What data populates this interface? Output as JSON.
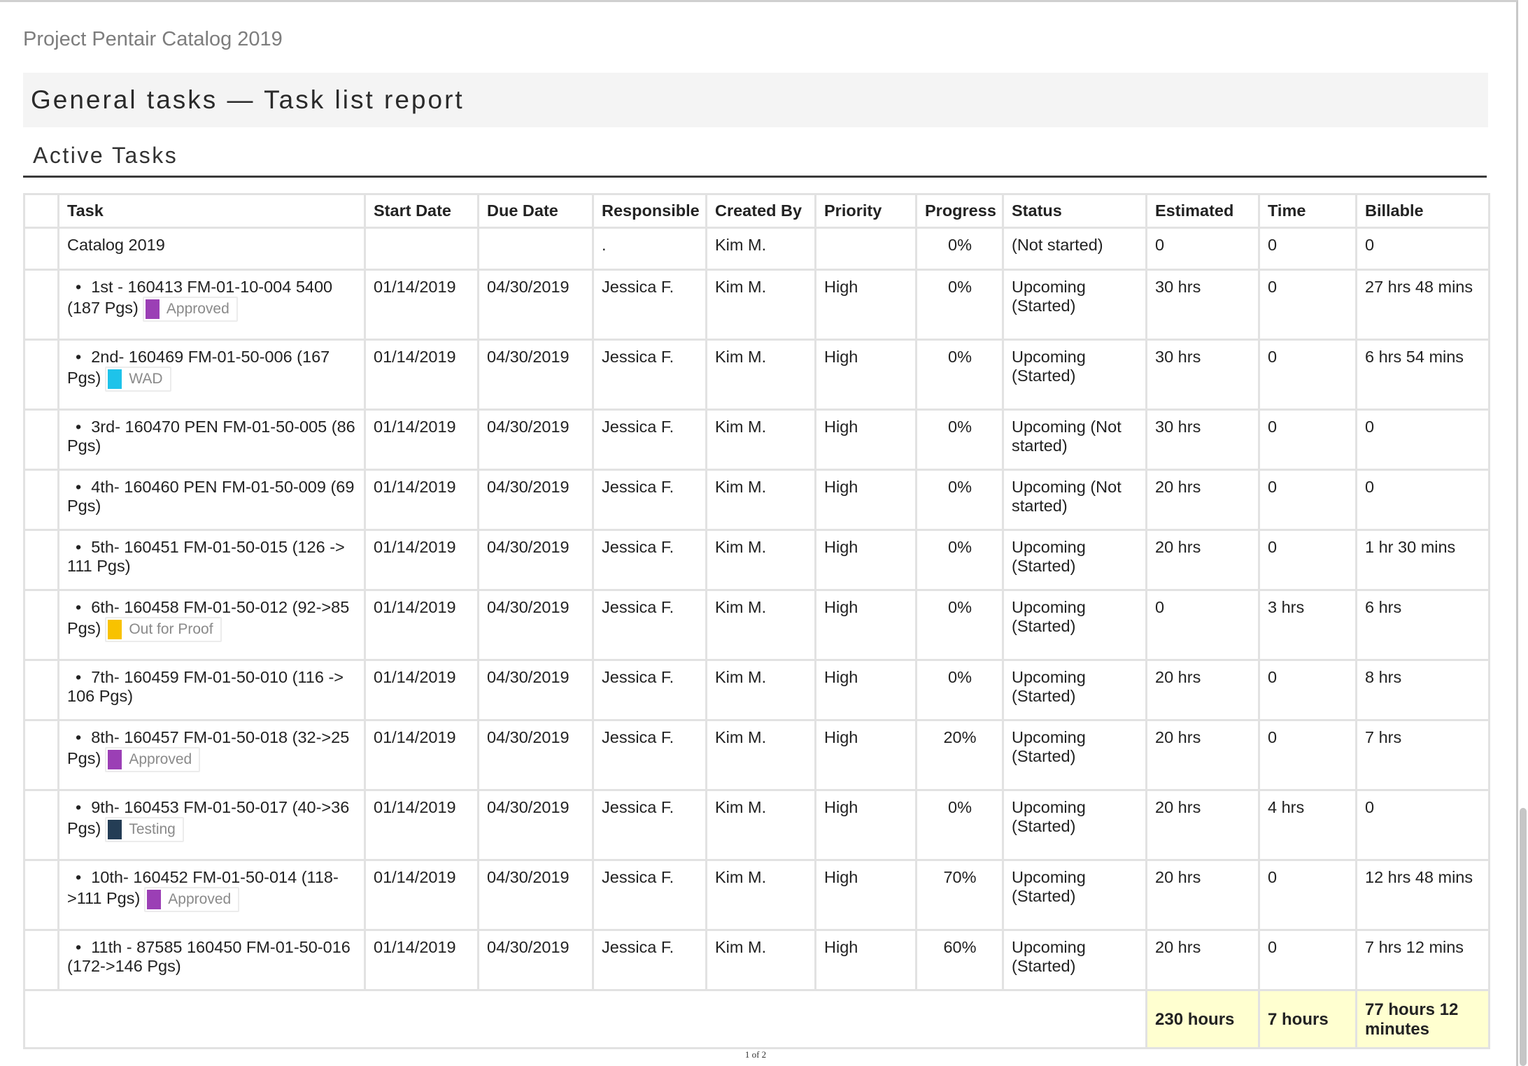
{
  "project_title": "Project Pentair Catalog 2019",
  "report_title": "General tasks — Task list report",
  "section_title": "Active Tasks",
  "columns": [
    "",
    "Task",
    "Start Date",
    "Due Date",
    "Responsible",
    "Created By",
    "Priority",
    "Progress",
    "Status",
    "Estimated",
    "Time",
    "Billable"
  ],
  "parent_task": {
    "task": "Catalog 2019",
    "start": "",
    "due": "",
    "responsible": ".",
    "created_by": "Kim M.",
    "priority": "",
    "progress": "0%",
    "status": "(Not started)",
    "estimated": "0",
    "time": "0",
    "billable": "0"
  },
  "bullet": "•",
  "tasks": [
    {
      "task": "1st - 160413 FM-01-10-004 5400 (187 Pgs)",
      "badge": "Approved",
      "badge_color": "#9b3fb5",
      "start": "01/14/2019",
      "due": "04/30/2019",
      "responsible": "Jessica F.",
      "created_by": "Kim M.",
      "priority": "High",
      "progress": "0%",
      "status": "Upcoming (Started)",
      "estimated": "30 hrs",
      "time": "0",
      "billable": "27 hrs 48 mins"
    },
    {
      "task": "2nd- 160469 FM-01-50-006 (167 Pgs)",
      "badge": "WAD",
      "badge_color": "#1ec3ea",
      "start": "01/14/2019",
      "due": "04/30/2019",
      "responsible": "Jessica F.",
      "created_by": "Kim M.",
      "priority": "High",
      "progress": "0%",
      "status": "Upcoming (Started)",
      "estimated": "30 hrs",
      "time": "0",
      "billable": "6 hrs 54 mins"
    },
    {
      "task": "3rd- 160470 PEN FM-01-50-005 (86 Pgs)",
      "badge": "",
      "badge_color": "",
      "start": "01/14/2019",
      "due": "04/30/2019",
      "responsible": "Jessica F.",
      "created_by": "Kim M.",
      "priority": "High",
      "progress": "0%",
      "status": "Upcoming (Not started)",
      "estimated": "30 hrs",
      "time": "0",
      "billable": "0"
    },
    {
      "task": "4th- 160460 PEN FM-01-50-009 (69 Pgs)",
      "badge": "",
      "badge_color": "",
      "start": "01/14/2019",
      "due": "04/30/2019",
      "responsible": "Jessica F.",
      "created_by": "Kim M.",
      "priority": "High",
      "progress": "0%",
      "status": "Upcoming (Not started)",
      "estimated": "20 hrs",
      "time": "0",
      "billable": "0"
    },
    {
      "task": "5th- 160451 FM-01-50-015 (126 -> 111 Pgs)",
      "badge": "",
      "badge_color": "",
      "start": "01/14/2019",
      "due": "04/30/2019",
      "responsible": "Jessica F.",
      "created_by": "Kim M.",
      "priority": "High",
      "progress": "0%",
      "status": "Upcoming (Started)",
      "estimated": "20 hrs",
      "time": "0",
      "billable": "1 hr 30 mins"
    },
    {
      "task": "6th- 160458 FM-01-50-012 (92->85 Pgs)",
      "badge": "Out for Proof",
      "badge_color": "#f8c200",
      "start": "01/14/2019",
      "due": "04/30/2019",
      "responsible": "Jessica F.",
      "created_by": "Kim M.",
      "priority": "High",
      "progress": "0%",
      "status": "Upcoming (Started)",
      "estimated": "0",
      "time": "3 hrs",
      "billable": "6 hrs"
    },
    {
      "task": "7th- 160459 FM-01-50-010 (116 -> 106 Pgs)",
      "badge": "",
      "badge_color": "",
      "start": "01/14/2019",
      "due": "04/30/2019",
      "responsible": "Jessica F.",
      "created_by": "Kim M.",
      "priority": "High",
      "progress": "0%",
      "status": "Upcoming (Started)",
      "estimated": "20 hrs",
      "time": "0",
      "billable": "8 hrs"
    },
    {
      "task": "8th- 160457 FM-01-50-018 (32->25 Pgs)",
      "badge": "Approved",
      "badge_color": "#9b3fb5",
      "start": "01/14/2019",
      "due": "04/30/2019",
      "responsible": "Jessica F.",
      "created_by": "Kim M.",
      "priority": "High",
      "progress": "20%",
      "status": "Upcoming (Started)",
      "estimated": "20 hrs",
      "time": "0",
      "billable": "7 hrs"
    },
    {
      "task": "9th- 160453 FM-01-50-017 (40->36 Pgs)",
      "badge": "Testing",
      "badge_color": "#243d55",
      "start": "01/14/2019",
      "due": "04/30/2019",
      "responsible": "Jessica F.",
      "created_by": "Kim M.",
      "priority": "High",
      "progress": "0%",
      "status": "Upcoming (Started)",
      "estimated": "20 hrs",
      "time": "4 hrs",
      "billable": "0"
    },
    {
      "task": "10th- 160452 FM-01-50-014 (118->111 Pgs)",
      "badge": "Approved",
      "badge_color": "#9b3fb5",
      "start": "01/14/2019",
      "due": "04/30/2019",
      "responsible": "Jessica F.",
      "created_by": "Kim M.",
      "priority": "High",
      "progress": "70%",
      "status": "Upcoming (Started)",
      "estimated": "20 hrs",
      "time": "0",
      "billable": "12 hrs 48 mins"
    },
    {
      "task": "11th - 87585 160450 FM-01-50-016 (172->146 Pgs)",
      "badge": "",
      "badge_color": "",
      "start": "01/14/2019",
      "due": "04/30/2019",
      "responsible": "Jessica F.",
      "created_by": "Kim M.",
      "priority": "High",
      "progress": "60%",
      "status": "Upcoming (Started)",
      "estimated": "20 hrs",
      "time": "0",
      "billable": "7 hrs 12 mins"
    }
  ],
  "totals": {
    "estimated": "230 hours",
    "time": "7 hours",
    "billable": "77 hours 12 minutes"
  },
  "page_number": "1 of 2",
  "colors": {
    "totals_background": "#ffffd0",
    "header_background": "#f4f4f4",
    "grid_line": "#e2e2e2"
  }
}
